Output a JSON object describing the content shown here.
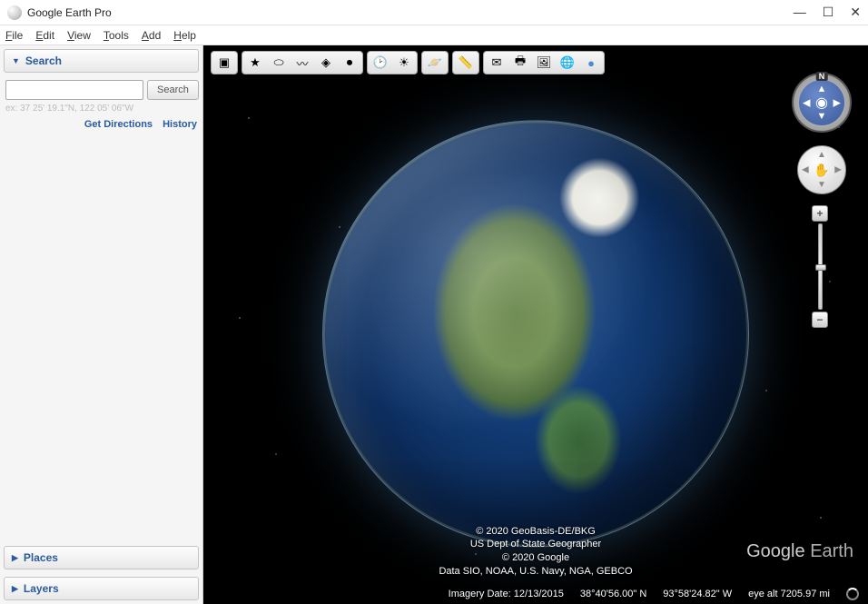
{
  "window": {
    "title": "Google Earth Pro"
  },
  "menu": {
    "file": "File",
    "edit": "Edit",
    "view": "View",
    "tools": "Tools",
    "add": "Add",
    "help": "Help"
  },
  "sidebar": {
    "search": {
      "title": "Search",
      "button": "Search",
      "hint": "ex: 37 25' 19.1\"N, 122 05' 06\"W",
      "directions": "Get Directions",
      "history": "History"
    },
    "places": {
      "title": "Places"
    },
    "layers": {
      "title": "Layers"
    }
  },
  "toolbar_icons": {
    "sidebar": "▣",
    "placemark": "★",
    "polygon": "⬭",
    "path": "〰",
    "image_overlay": "◈",
    "record": "⏺",
    "historical": "🕑",
    "sun": "☀",
    "planet": "🪐",
    "ruler": "📏",
    "email": "✉",
    "print": "🖶",
    "save_image": "🖼",
    "kml": "🌐",
    "view_in_maps": "●"
  },
  "attribution": {
    "l1": "© 2020 GeoBasis-DE/BKG",
    "l2": "US Dept of State Geographer",
    "l3": "© 2020 Google",
    "l4": "Data SIO, NOAA, U.S. Navy, NGA, GEBCO"
  },
  "status": {
    "imagery_date": "Imagery Date: 12/13/2015",
    "lat": "38°40'56.00\" N",
    "lon": "93°58'24.82\" W",
    "alt": "eye alt 7205.97 mi"
  },
  "watermark": {
    "a": "Google ",
    "b": "Earth"
  },
  "nav": {
    "north": "N"
  }
}
